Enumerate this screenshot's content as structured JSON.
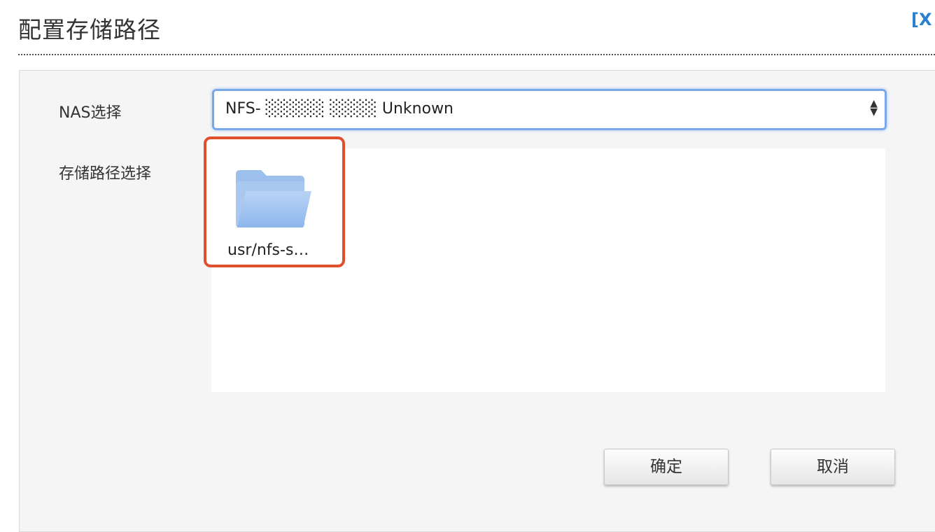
{
  "dialog": {
    "title": "配置存储路径",
    "close_label": "[X"
  },
  "form": {
    "nas_label": "NAS选择",
    "nas_selected": "NFS-  ░░░░░   ░░░░ Unknown",
    "path_label": "存储路径选择"
  },
  "folders": [
    {
      "name": "usr/nfs-s…",
      "icon": "folder-icon",
      "selected": true
    }
  ],
  "buttons": {
    "ok_label": "确定",
    "cancel_label": "取消"
  },
  "colors": {
    "select_border": "#7aa7ea",
    "highlight": "#e0502f",
    "close": "#2a7fd0"
  }
}
